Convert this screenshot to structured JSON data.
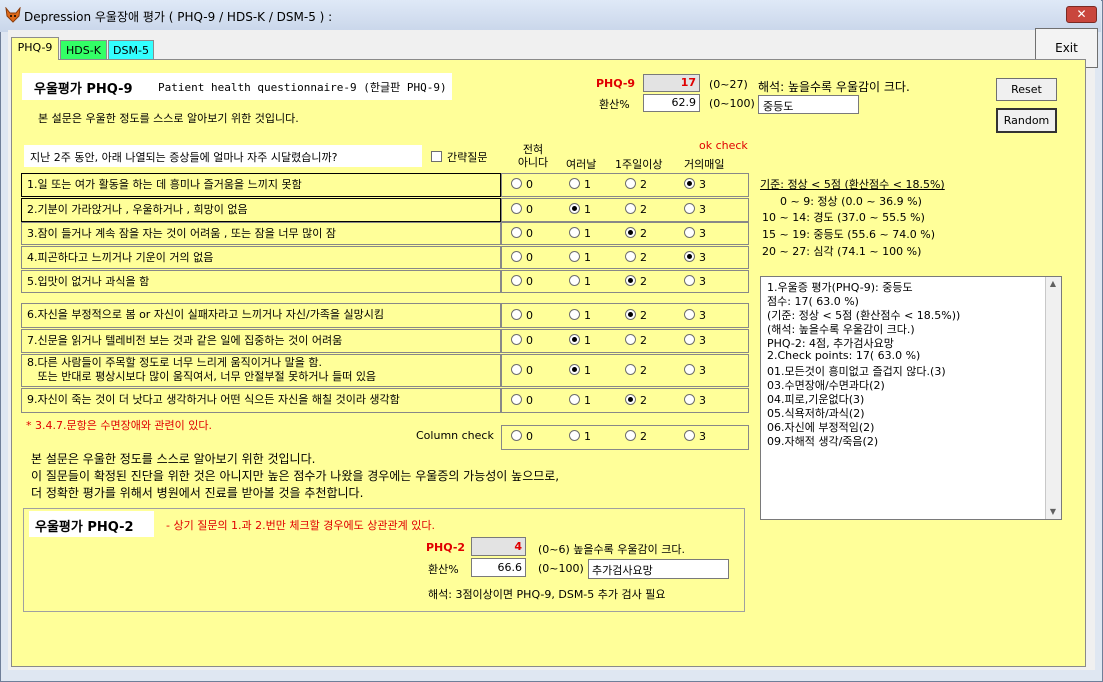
{
  "window": {
    "title": "Depression 우울장애 평가 ( PHQ-9 / HDS-K / DSM-5 ) :",
    "close_label": "✕",
    "exit_label": "Exit"
  },
  "tabs": [
    {
      "label": "PHQ-9",
      "color": "#ffff99"
    },
    {
      "label": "HDS-K",
      "color": "#33ff66"
    },
    {
      "label": "DSM-5",
      "color": "#33ffff"
    }
  ],
  "header": {
    "title_bold": "우울평가 PHQ-9",
    "title_rest": "Patient health questionnaire-9 (한글판 PHQ-9)",
    "subtitle": "본 설문은 우울한 정도를 스스로 알아보기 위한 것입니다."
  },
  "score": {
    "phq9_label": "PHQ-9",
    "phq9_value": "17",
    "phq9_range": "(0~27)",
    "interpretation": "해석: 높을수록 우울감이 크다.",
    "pct_label": "환산%",
    "pct_value": "62.9",
    "pct_range": "(0~100)",
    "severity": "중등도"
  },
  "buttons": {
    "reset": "Reset",
    "random": "Random"
  },
  "prompt": "지난 2주 동안, 아래 나열되는 증상들에 얼마나 자주 시달렸습니까?",
  "brief_label": "간략질문",
  "ok_check": "ok check",
  "columns": [
    "전혀\n아니다",
    "여러날",
    "1주일이상",
    "거의매일"
  ],
  "questions": [
    {
      "text": "1.일 또는 여가 활동을 하는 데 흥미나 즐거움을 느끼지 못함",
      "selected": 3
    },
    {
      "text": "2.기분이 가라앉거나 , 우울하거나 , 희망이 없음",
      "selected": 1
    },
    {
      "text": "3.잠이 들거나 계속 잠을 자는 것이 어려움 , 또는 잠을 너무 많이 잠",
      "selected": 2
    },
    {
      "text": "4.피곤하다고 느끼거나 기운이 거의 없음",
      "selected": 3
    },
    {
      "text": "5.입맛이 없거나 과식을 함",
      "selected": 2
    },
    {
      "text": "6.자신을 부정적으로 봄 or 자신이 실패자라고 느끼거나 자신/가족을 실망시킴",
      "selected": 2
    },
    {
      "text": "7.신문을 읽거나 텔레비전 보는 것과 같은 일에 집중하는 것이 어려움",
      "selected": 1
    },
    {
      "text": "8.다른 사람들이 주목할 정도로 너무 느리게 움직이거나 말을 함.\n   또는 반대로 평상시보다 많이 움직여서, 너무 안절부절 못하거나 들떠 있음",
      "selected": 1
    },
    {
      "text": "9.자신이 죽는 것이 더 낫다고 생각하거나 어떤 식으든 자신을 해칠 것이라 생각함",
      "selected": 2
    }
  ],
  "option_values": [
    "0",
    "1",
    "2",
    "3"
  ],
  "note_red": "* 3.4.7.문항은 수면장애와 관련이 있다.",
  "column_check": "Column check",
  "criteria": [
    "기준: 정상 < 5점 (환산점수 < 18.5%)",
    "0 ~ 9: 정상 (0.0 ~ 36.9 %)",
    "10 ~ 14: 경도 (37.0 ~ 55.5 %)",
    "15 ~ 19: 중등도 (55.6 ~ 74.0 %)",
    "20 ~ 27: 심각 (74.1 ~ 100 %)"
  ],
  "result_lines": [
    "1.우울증 평가(PHQ-9): 중등도",
    "  점수: 17( 63.0 %)",
    "  (기준: 정상 < 5점 (환산점수 < 18.5%))",
    "  (해석: 높을수록 우울감이 크다.)",
    "  PHQ-2: 4점, 추가검사요망",
    "2.Check points: 17( 63.0 %)",
    "  01.모든것이 흥미없고 즐겁지 않다.(3)",
    "  03.수면장애/수면과다(2)",
    "  04.피로,기운없다(3)",
    "  05.식욕저하/과식(2)",
    "  06.자신에 부정적임(2)",
    "  09.자해적 생각/죽음(2)"
  ],
  "footer_text": [
    "본 설문은 우울한 정도를 스스로 알아보기 위한 것입니다.",
    "이 질문들이 확정된 진단을 위한 것은 아니지만 높은 점수가 나왔을 경우에는 우울증의 가능성이 높으므로,",
    "더 정확한 평가를 위해서 병원에서 진료를 받아볼 것을 추천합니다."
  ],
  "phq2": {
    "title": "우울평가 PHQ-2",
    "note": "- 상기 질문의 1.과 2.번만 체크할 경우에도 상관관계 있다.",
    "label": "PHQ-2",
    "value": "4",
    "range": "(0~6) 높을수록 우울감이 크다.",
    "pct_label": "환산%",
    "pct_value": "66.6",
    "pct_range": "(0~100)",
    "result": "추가검사요망",
    "interpretation": "해석: 3점이상이면 PHQ-9, DSM-5 추가 검사 필요"
  }
}
